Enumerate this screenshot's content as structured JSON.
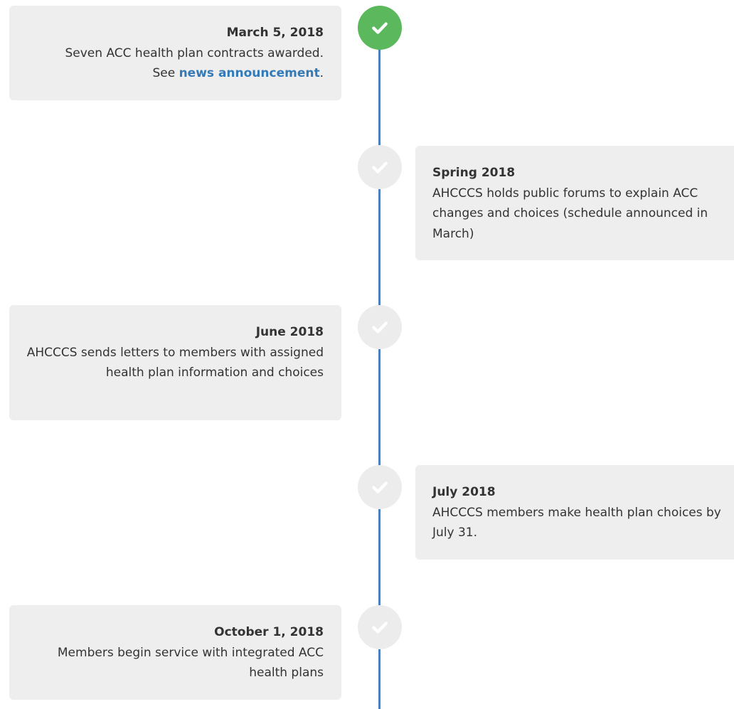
{
  "timeline": {
    "events": [
      {
        "date": "March 5, 2018",
        "text_line1": "Seven ACC health plan contracts awarded.",
        "text_prefix": "See ",
        "link_label": "news announcement",
        "text_suffix": ".",
        "status": "completed",
        "icon": "check-icon"
      },
      {
        "date": "Spring 2018",
        "text": "AHCCCS holds public forums to explain ACC changes and choices (schedule announced in March)",
        "status": "upcoming",
        "icon": "check-icon"
      },
      {
        "date": "June 2018",
        "text": "AHCCCS sends letters to members with assigned health plan information and choices",
        "status": "upcoming",
        "icon": "check-icon"
      },
      {
        "date": "July 2018",
        "text": "AHCCCS members make health plan choices by July 31.",
        "status": "upcoming",
        "icon": "check-icon"
      },
      {
        "date": "October 1, 2018",
        "text": "Members begin service with integrated ACC health plans",
        "status": "upcoming",
        "icon": "check-icon"
      }
    ]
  },
  "colors": {
    "line": "#4a7fc1",
    "completed_node": "#5cb85c",
    "pending_node": "#ececec",
    "card_background": "#eeeeee",
    "link": "#337ab7"
  }
}
